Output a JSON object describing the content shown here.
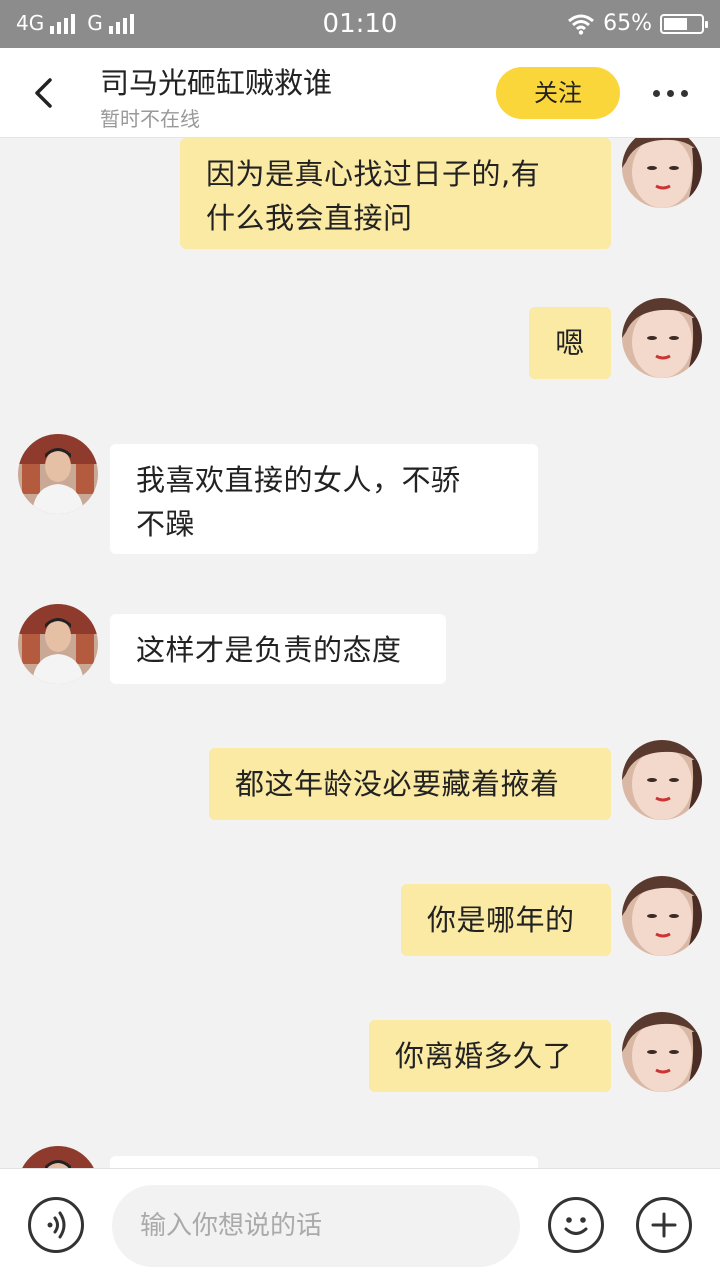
{
  "status_bar": {
    "network1": "4G",
    "network2": "G",
    "time": "01:10",
    "battery": "65%",
    "battery_level": 0.65
  },
  "header": {
    "title": "司马光砸缸贼救谁",
    "subtitle": "暂时不在线",
    "follow_label": "关注"
  },
  "messages": [
    {
      "side": "mine",
      "text": "因为是真心找过日子的,有\n什么我会直接问"
    },
    {
      "side": "mine",
      "text": "嗯"
    },
    {
      "side": "theirs",
      "text": "我喜欢直接的女人，不骄\n不躁"
    },
    {
      "side": "theirs",
      "text": "这样才是负责的态度"
    },
    {
      "side": "mine",
      "text": "都这年龄没必要藏着掖着"
    },
    {
      "side": "mine",
      "text": "你是哪年的"
    },
    {
      "side": "mine",
      "text": "你离婚多久了"
    },
    {
      "side": "theirs",
      "text": ""
    }
  ],
  "input": {
    "placeholder": "输入你想说的话"
  },
  "icons": {
    "back": "back-arrow-icon",
    "more": "more-dots-icon",
    "voice": "voice-icon",
    "emoji": "emoji-icon",
    "plus": "plus-icon"
  },
  "colors": {
    "accent": "#fbd63a",
    "my_bubble": "#faeaa4",
    "their_bubble": "#ffffff",
    "background": "#f2f2f2"
  }
}
